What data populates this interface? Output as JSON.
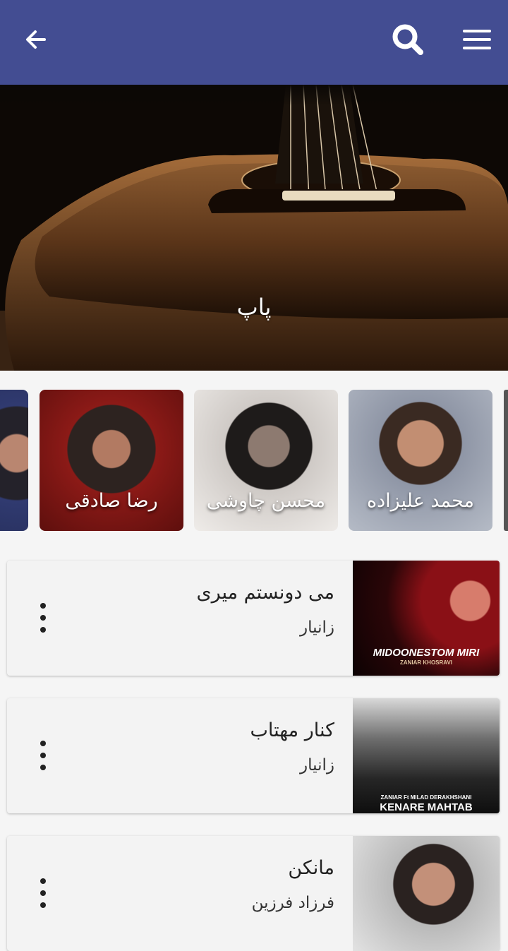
{
  "appbar": {
    "back_icon": "arrow-left-icon",
    "search_icon": "search-icon",
    "menu_icon": "menu-icon",
    "color": "#434d92"
  },
  "hero": {
    "title": "پاپ"
  },
  "artists": [
    {
      "name": "محمد علیزاده"
    },
    {
      "name": "محسن چاوشی"
    },
    {
      "name": "رضا صادقی"
    },
    {
      "name": ""
    }
  ],
  "songs": [
    {
      "title": "می دونستم میری",
      "artist": "زانیار",
      "cover_text": "MIDOONESTOM MIRI",
      "cover_subtext": "ZANIAR KHOSRAVI"
    },
    {
      "title": "کنار مهتاب",
      "artist": "زانیار",
      "cover_text": "KENARE MAHTAB",
      "cover_subtext": "ZANIAR Ft MILAD DERAKHSHANI"
    },
    {
      "title": "مانکن",
      "artist": "فرزاد فرزین"
    }
  ]
}
